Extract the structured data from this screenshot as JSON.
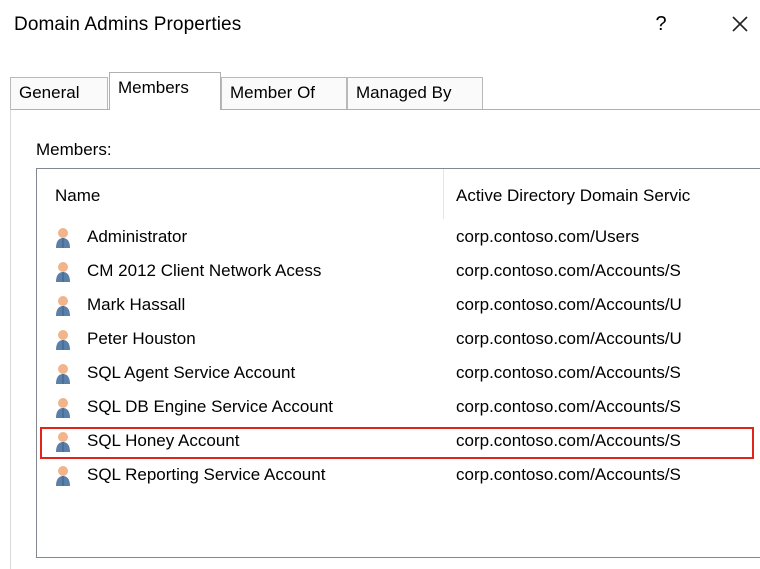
{
  "window": {
    "title": "Domain Admins Properties",
    "help_label": "?"
  },
  "tabs": [
    {
      "label": "General",
      "active": false
    },
    {
      "label": "Members",
      "active": true
    },
    {
      "label": "Member Of",
      "active": false
    },
    {
      "label": "Managed By",
      "active": false
    }
  ],
  "members_section": {
    "label": "Members:",
    "columns": [
      "Name",
      "Active Directory Domain Servic"
    ],
    "rows": [
      {
        "name": "Administrator",
        "folder": "corp.contoso.com/Users"
      },
      {
        "name": "CM 2012 Client Network Acess",
        "folder": "corp.contoso.com/Accounts/S"
      },
      {
        "name": "Mark Hassall",
        "folder": "corp.contoso.com/Accounts/U"
      },
      {
        "name": "Peter Houston",
        "folder": "corp.contoso.com/Accounts/U"
      },
      {
        "name": "SQL Agent Service Account",
        "folder": "corp.contoso.com/Accounts/S"
      },
      {
        "name": "SQL DB Engine Service Account",
        "folder": "corp.contoso.com/Accounts/S"
      },
      {
        "name": "SQL Honey Account",
        "folder": "corp.contoso.com/Accounts/S"
      },
      {
        "name": "SQL Reporting Service Account",
        "folder": "corp.contoso.com/Accounts/S"
      }
    ],
    "highlighted_row": "SQL Honey Account"
  },
  "colors": {
    "highlight_border": "#e0241a",
    "user_icon_head": "#f2b48a",
    "user_icon_body": "#5a7fa8"
  },
  "icons": {
    "row_icon": "user-icon",
    "close": "close-icon"
  }
}
